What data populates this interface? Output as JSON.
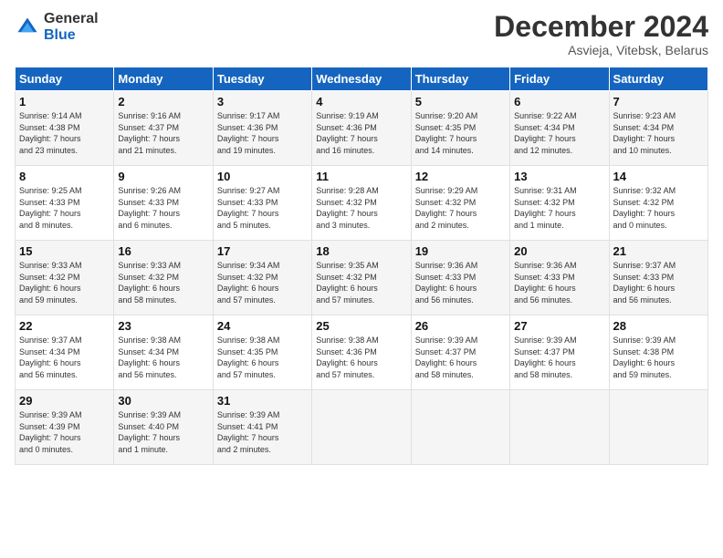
{
  "header": {
    "logo_general": "General",
    "logo_blue": "Blue",
    "month_title": "December 2024",
    "location": "Asvieja, Vitebsk, Belarus"
  },
  "weekdays": [
    "Sunday",
    "Monday",
    "Tuesday",
    "Wednesday",
    "Thursday",
    "Friday",
    "Saturday"
  ],
  "weeks": [
    [
      {
        "day": "1",
        "lines": [
          "Sunrise: 9:14 AM",
          "Sunset: 4:38 PM",
          "Daylight: 7 hours",
          "and 23 minutes."
        ]
      },
      {
        "day": "2",
        "lines": [
          "Sunrise: 9:16 AM",
          "Sunset: 4:37 PM",
          "Daylight: 7 hours",
          "and 21 minutes."
        ]
      },
      {
        "day": "3",
        "lines": [
          "Sunrise: 9:17 AM",
          "Sunset: 4:36 PM",
          "Daylight: 7 hours",
          "and 19 minutes."
        ]
      },
      {
        "day": "4",
        "lines": [
          "Sunrise: 9:19 AM",
          "Sunset: 4:36 PM",
          "Daylight: 7 hours",
          "and 16 minutes."
        ]
      },
      {
        "day": "5",
        "lines": [
          "Sunrise: 9:20 AM",
          "Sunset: 4:35 PM",
          "Daylight: 7 hours",
          "and 14 minutes."
        ]
      },
      {
        "day": "6",
        "lines": [
          "Sunrise: 9:22 AM",
          "Sunset: 4:34 PM",
          "Daylight: 7 hours",
          "and 12 minutes."
        ]
      },
      {
        "day": "7",
        "lines": [
          "Sunrise: 9:23 AM",
          "Sunset: 4:34 PM",
          "Daylight: 7 hours",
          "and 10 minutes."
        ]
      }
    ],
    [
      {
        "day": "8",
        "lines": [
          "Sunrise: 9:25 AM",
          "Sunset: 4:33 PM",
          "Daylight: 7 hours",
          "and 8 minutes."
        ]
      },
      {
        "day": "9",
        "lines": [
          "Sunrise: 9:26 AM",
          "Sunset: 4:33 PM",
          "Daylight: 7 hours",
          "and 6 minutes."
        ]
      },
      {
        "day": "10",
        "lines": [
          "Sunrise: 9:27 AM",
          "Sunset: 4:33 PM",
          "Daylight: 7 hours",
          "and 5 minutes."
        ]
      },
      {
        "day": "11",
        "lines": [
          "Sunrise: 9:28 AM",
          "Sunset: 4:32 PM",
          "Daylight: 7 hours",
          "and 3 minutes."
        ]
      },
      {
        "day": "12",
        "lines": [
          "Sunrise: 9:29 AM",
          "Sunset: 4:32 PM",
          "Daylight: 7 hours",
          "and 2 minutes."
        ]
      },
      {
        "day": "13",
        "lines": [
          "Sunrise: 9:31 AM",
          "Sunset: 4:32 PM",
          "Daylight: 7 hours",
          "and 1 minute."
        ]
      },
      {
        "day": "14",
        "lines": [
          "Sunrise: 9:32 AM",
          "Sunset: 4:32 PM",
          "Daylight: 7 hours",
          "and 0 minutes."
        ]
      }
    ],
    [
      {
        "day": "15",
        "lines": [
          "Sunrise: 9:33 AM",
          "Sunset: 4:32 PM",
          "Daylight: 6 hours",
          "and 59 minutes."
        ]
      },
      {
        "day": "16",
        "lines": [
          "Sunrise: 9:33 AM",
          "Sunset: 4:32 PM",
          "Daylight: 6 hours",
          "and 58 minutes."
        ]
      },
      {
        "day": "17",
        "lines": [
          "Sunrise: 9:34 AM",
          "Sunset: 4:32 PM",
          "Daylight: 6 hours",
          "and 57 minutes."
        ]
      },
      {
        "day": "18",
        "lines": [
          "Sunrise: 9:35 AM",
          "Sunset: 4:32 PM",
          "Daylight: 6 hours",
          "and 57 minutes."
        ]
      },
      {
        "day": "19",
        "lines": [
          "Sunrise: 9:36 AM",
          "Sunset: 4:33 PM",
          "Daylight: 6 hours",
          "and 56 minutes."
        ]
      },
      {
        "day": "20",
        "lines": [
          "Sunrise: 9:36 AM",
          "Sunset: 4:33 PM",
          "Daylight: 6 hours",
          "and 56 minutes."
        ]
      },
      {
        "day": "21",
        "lines": [
          "Sunrise: 9:37 AM",
          "Sunset: 4:33 PM",
          "Daylight: 6 hours",
          "and 56 minutes."
        ]
      }
    ],
    [
      {
        "day": "22",
        "lines": [
          "Sunrise: 9:37 AM",
          "Sunset: 4:34 PM",
          "Daylight: 6 hours",
          "and 56 minutes."
        ]
      },
      {
        "day": "23",
        "lines": [
          "Sunrise: 9:38 AM",
          "Sunset: 4:34 PM",
          "Daylight: 6 hours",
          "and 56 minutes."
        ]
      },
      {
        "day": "24",
        "lines": [
          "Sunrise: 9:38 AM",
          "Sunset: 4:35 PM",
          "Daylight: 6 hours",
          "and 57 minutes."
        ]
      },
      {
        "day": "25",
        "lines": [
          "Sunrise: 9:38 AM",
          "Sunset: 4:36 PM",
          "Daylight: 6 hours",
          "and 57 minutes."
        ]
      },
      {
        "day": "26",
        "lines": [
          "Sunrise: 9:39 AM",
          "Sunset: 4:37 PM",
          "Daylight: 6 hours",
          "and 58 minutes."
        ]
      },
      {
        "day": "27",
        "lines": [
          "Sunrise: 9:39 AM",
          "Sunset: 4:37 PM",
          "Daylight: 6 hours",
          "and 58 minutes."
        ]
      },
      {
        "day": "28",
        "lines": [
          "Sunrise: 9:39 AM",
          "Sunset: 4:38 PM",
          "Daylight: 6 hours",
          "and 59 minutes."
        ]
      }
    ],
    [
      {
        "day": "29",
        "lines": [
          "Sunrise: 9:39 AM",
          "Sunset: 4:39 PM",
          "Daylight: 7 hours",
          "and 0 minutes."
        ]
      },
      {
        "day": "30",
        "lines": [
          "Sunrise: 9:39 AM",
          "Sunset: 4:40 PM",
          "Daylight: 7 hours",
          "and 1 minute."
        ]
      },
      {
        "day": "31",
        "lines": [
          "Sunrise: 9:39 AM",
          "Sunset: 4:41 PM",
          "Daylight: 7 hours",
          "and 2 minutes."
        ]
      },
      null,
      null,
      null,
      null
    ]
  ]
}
